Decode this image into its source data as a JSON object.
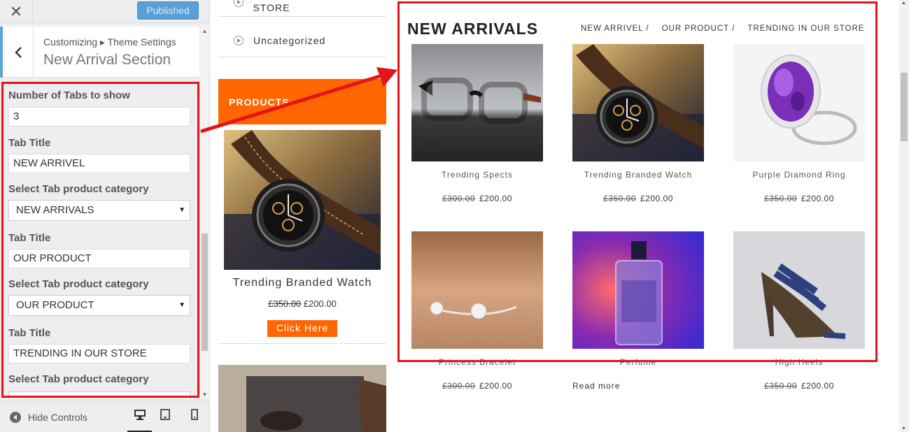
{
  "sidebar": {
    "close_icon": "✕",
    "publish_label": "Published",
    "back_icon": "‹",
    "breadcrumb": "Customizing ▸ Theme Settings",
    "section_title": "New Arrival Section",
    "controls": {
      "num_tabs_label": "Number of Tabs to show",
      "num_tabs_value": "3",
      "tab1_title_label": "Tab Title",
      "tab1_title_value": "NEW ARRIVEL",
      "tab1_category_label": "Select Tab product category",
      "tab1_category_value": "NEW ARRIVALS",
      "tab2_title_label": "Tab Title",
      "tab2_title_value": "OUR PRODUCT",
      "tab2_category_label": "Select Tab product category",
      "tab2_category_value": "OUR PRODUCT",
      "tab3_title_label": "Tab Title",
      "tab3_title_value": "TRENDING IN OUR STORE",
      "tab3_category_label": "Select Tab product category"
    },
    "footer": {
      "hide_controls_label": "Hide Controls",
      "devices": [
        "desktop-icon",
        "tablet-icon",
        "mobile-icon"
      ]
    }
  },
  "preview": {
    "categories": [
      "TRENDING IN OUR STORE",
      "Uncategorized"
    ],
    "products_widget": {
      "title": "PRODUCTS",
      "product_name": "Trending Branded Watch",
      "old_price": "£350.00",
      "price": "£200.00",
      "button_label": "Click Here"
    },
    "new_arrivals": {
      "title": "NEW ARRIVALS",
      "tabs": [
        "NEW ARRIVEL /",
        "OUR PRODUCT /",
        "TRENDING IN OUR STORE"
      ],
      "products": [
        {
          "name": "Trending Spects",
          "old_price": "£300.00",
          "price": "£200.00"
        },
        {
          "name": "Trending Branded Watch",
          "old_price": "£350.00",
          "price": "£200.00"
        },
        {
          "name": "Purple Diamond Ring",
          "old_price": "£350.00",
          "price": "£200.00"
        },
        {
          "name": "Princess Bracelet",
          "old_price": "£300.00",
          "price": "£200.00"
        },
        {
          "name": "Perfume",
          "read_more": "Read more"
        },
        {
          "name": "High Heels",
          "old_price": "£350.00",
          "price": "£200.00"
        }
      ]
    }
  },
  "colors": {
    "accent_orange": "#ff6600",
    "highlight_red": "#e8121a",
    "publish_blue": "#5a9fd6"
  }
}
